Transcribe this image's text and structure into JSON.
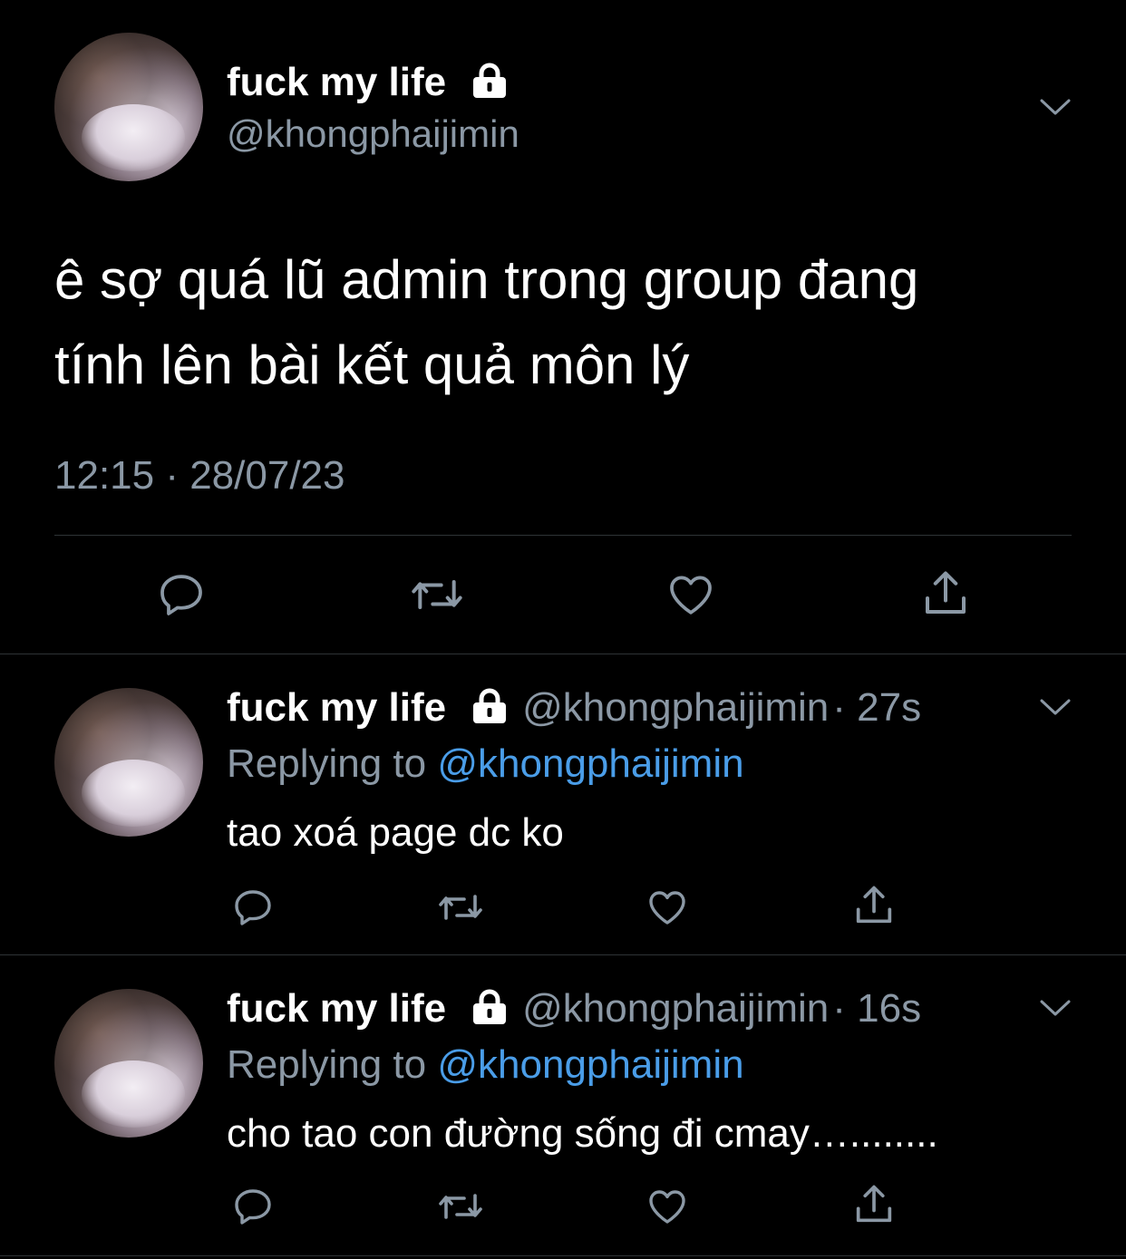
{
  "main_tweet": {
    "display_name": "fuck my life",
    "handle": "@khongphaijimin",
    "text_line1": "ê sợ quá lũ admin trong group đang",
    "text_line2": "tính lên bài kết quả môn lý",
    "timestamp": "12:15 · 28/07/23"
  },
  "replies": [
    {
      "display_name": "fuck my life",
      "handle": "@khongphaijimin",
      "age": "· 27s",
      "replying_prefix": "Replying to",
      "replying_to": "@khongphaijimin",
      "text": "tao xoá page dc ko"
    },
    {
      "display_name": "fuck my life",
      "handle": "@khongphaijimin",
      "age": "· 16s",
      "replying_prefix": "Replying to",
      "replying_to": "@khongphaijimin",
      "text": "cho tao con đường sống đi cmay…........"
    }
  ],
  "icons": {
    "reply": "reply-icon",
    "retweet": "retweet-icon",
    "like": "heart-icon",
    "share": "share-icon",
    "more": "chevron-down-icon",
    "protected": "lock-icon"
  },
  "colors": {
    "background": "#000000",
    "text": "#ffffff",
    "secondary": "#8b98a5",
    "link": "#4a9de8",
    "divider": "#2f3336"
  }
}
